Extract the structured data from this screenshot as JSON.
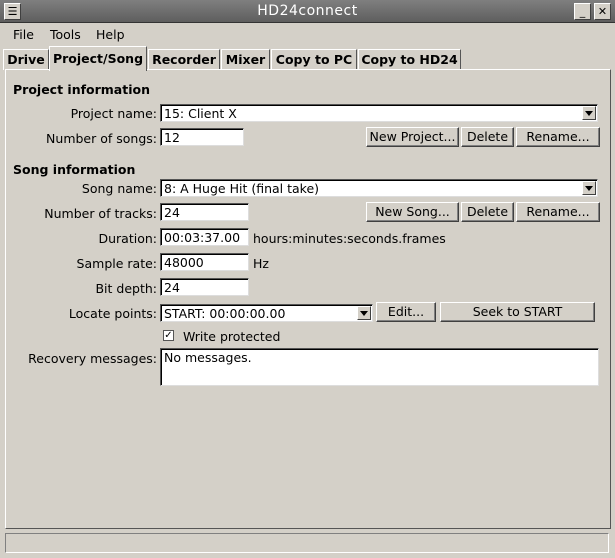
{
  "window": {
    "title": "HD24connect"
  },
  "menu": {
    "file": "File",
    "tools": "Tools",
    "help": "Help"
  },
  "tabs": [
    "Drive",
    "Project/Song",
    "Recorder",
    "Mixer",
    "Copy to PC",
    "Copy to HD24"
  ],
  "project": {
    "header": "Project information",
    "name_label": "Project name:",
    "name_value": "15: Client X",
    "songs_label": "Number of songs:",
    "songs_value": "12",
    "new_button": "New Project...",
    "delete_button": "Delete",
    "rename_button": "Rename..."
  },
  "song": {
    "header": "Song information",
    "name_label": "Song name:",
    "name_value": "8: A Huge Hit (final take)",
    "tracks_label": "Number of tracks:",
    "tracks_value": "24",
    "new_button": "New Song...",
    "delete_button": "Delete",
    "rename_button": "Rename...",
    "duration_label": "Duration:",
    "duration_value": "00:03:37.00",
    "duration_unit": "hours:minutes:seconds.frames",
    "rate_label": "Sample rate:",
    "rate_value": "48000",
    "rate_unit": "Hz",
    "depth_label": "Bit depth:",
    "depth_value": "24",
    "locate_label": "Locate points:",
    "locate_value": "START: 00:00:00.00",
    "edit_button": "Edit...",
    "seek_button": "Seek to START",
    "write_protected_label": "Write protected",
    "write_protected": true,
    "recovery_label": "Recovery messages:",
    "recovery_value": "No messages."
  },
  "status": {
    "text": ""
  }
}
